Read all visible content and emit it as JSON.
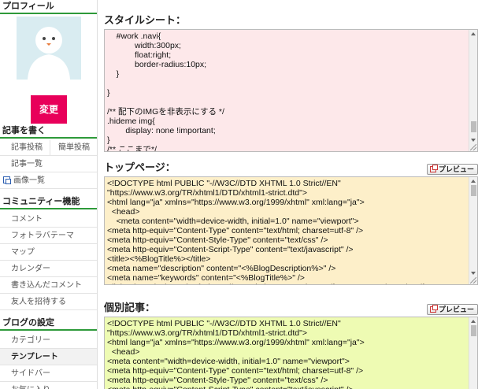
{
  "sidebar": {
    "profile_heading": "プロフィール",
    "change_button": "変更",
    "write_heading": "記事を書く",
    "write_items": [
      "記事投稿",
      "簡単投稿"
    ],
    "list_item": "記事一覧",
    "images_item": "画像一覧",
    "community_heading": "コミュニティー機能",
    "community_items": [
      "コメント",
      "フォトラバテーマ",
      "マップ",
      "カレンダー",
      "書き込んだコメント",
      "友人を招待する"
    ],
    "settings_heading": "ブログの設定",
    "settings_items": [
      "カテゴリー",
      "テンプレート",
      "サイドバー",
      "お気に入り"
    ]
  },
  "main": {
    "stylesheet": {
      "title": "スタイルシート：",
      "code": "    #work .navi{\n            width:300px;\n            float:right;\n            border-radius:10px;\n    }\n\n}\n\n/** 配下のIMGを非表示にする */\n.hideme img{\n        display: none !important;\n}\n/** ここまで*/"
    },
    "top_page": {
      "title": "トップページ：",
      "preview_label": "プレビュー",
      "code": "<!DOCTYPE html PUBLIC \"-//W3C//DTD XHTML 1.0 Strict//EN\"\n\"https://www.w3.org/TR/xhtml1/DTD/xhtml1-strict.dtd\">\n<html lang=\"ja\" xmlns=\"https://www.w3.org/1999/xhtml\" xml:lang=\"ja\">\n  <head>\n    <meta content=\"width=device-width, initial=1.0\" name=\"viewport\">\n<meta http-equiv=\"Content-Type\" content=\"text/html; charset=utf-8\" />\n<meta http-equiv=\"Content-Style-Type\" content=\"text/css\" />\n<meta http-equiv=\"Content-Script-Type\" content=\"text/javascript\" />\n<title><%BlogTitle%></title>\n<meta name=\"description\" content=\"<%BlogDescription%>\" />\n<meta name=\"keywords\" content=\"<%BlogTitle%>\" />\n<link rel=\"stylesheet\" href=\"https://maxcdn.bootstrapcdn.com/font-awesome/4.6.1/css/font-\nawesome.min.css\">"
    },
    "entry": {
      "title": "個別記事：",
      "preview_label": "プレビュー",
      "code": "<!DOCTYPE html PUBLIC \"-//W3C//DTD XHTML 1.0 Strict//EN\"\n\"https://www.w3.org/TR/xhtml1/DTD/xhtml1-strict.dtd\">\n<html lang=\"ja\" xmlns=\"https://www.w3.org/1999/xhtml\" xml:lang=\"ja\">\n  <head>\n<meta content=\"width=device-width, initial=1.0\" name=\"viewport\">\n<meta http-equiv=\"Content-Type\" content=\"text/html; charset=utf-8\" />\n<meta http-equiv=\"Content-Style-Type\" content=\"text/css\" />\n<meta http-equiv=\"Content-Script-Type\" content=\"text/javascript\" />"
    }
  },
  "colors": {
    "accent_green": "#2e9a3a",
    "change_button": "#e8005a",
    "stylesheet_bg": "#fde8ea",
    "top_page_bg": "#fdefc9",
    "entry_bg": "#eefbb3"
  }
}
